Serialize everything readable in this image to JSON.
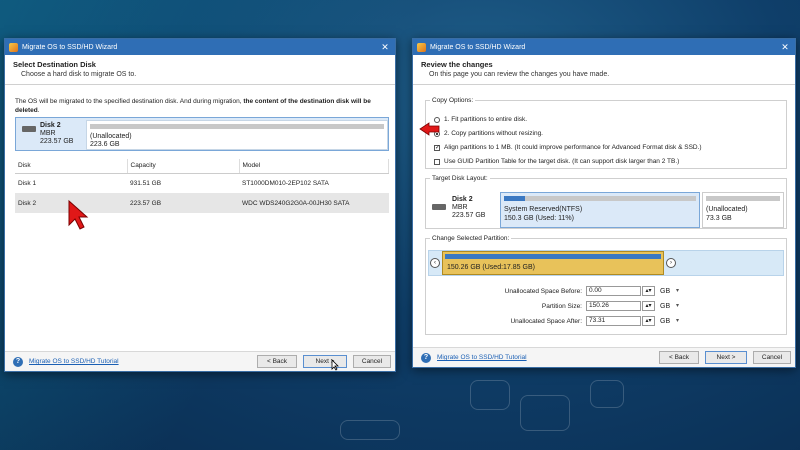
{
  "left_window": {
    "title": "Migrate OS to SSD/HD Wizard",
    "close_glyph": "✕",
    "header_title": "Select Destination Disk",
    "header_subtitle": "Choose a hard disk to migrate OS to.",
    "note_plain": "The OS will be migrated to the specified destination disk. And during migration, ",
    "note_bold": "the content of the destination disk will be deleted",
    "note_end": ".",
    "disk_card": {
      "name": "Disk 2",
      "type": "MBR",
      "size": "223.57 GB",
      "part_label": "(Unallocated)",
      "part_size": "223.6 GB"
    },
    "table": {
      "headers": [
        "Disk",
        "Capacity",
        "Model"
      ],
      "rows": [
        {
          "disk": "Disk 1",
          "capacity": "931.51 GB",
          "model": "ST1000DM010-2EP102 SATA"
        },
        {
          "disk": "Disk 2",
          "capacity": "223.57 GB",
          "model": "WDC WDS240G2G0A-00JH30 SATA"
        }
      ]
    },
    "help_glyph": "?",
    "tutorial_link": "Migrate OS to SSD/HD Tutorial",
    "back_label": "< Back",
    "next_label": "Next >",
    "cancel_label": "Cancel"
  },
  "right_window": {
    "title": "Migrate OS to SSD/HD Wizard",
    "close_glyph": "✕",
    "header_title": "Review the changes",
    "header_subtitle": "On this page you can review the changes you have made.",
    "copy_options": {
      "legend": "Copy Options:",
      "opt1": "1. Fit partitions to entire disk.",
      "opt2": "2. Copy partitions without resizing.",
      "opt3": "Align partitions to 1 MB.  (It could improve performance for Advanced Format disk & SSD.)",
      "opt4": "Use GUID Partition Table for the target disk. (It can support disk larger than 2 TB.)",
      "check_glyph": "✓"
    },
    "target_layout": {
      "legend": "Target Disk Layout:",
      "disk_name": "Disk 2",
      "disk_type": "MBR",
      "disk_size": "223.57 GB",
      "part1_label": "System Reserved(NTFS)",
      "part1_size": "150.3 GB (Used: 11%)",
      "part1_used_fraction": 0.11,
      "part2_label": "(Unallocated)",
      "part2_size": "73.3 GB"
    },
    "change_partition": {
      "legend": "Change Selected Partition:",
      "part_label": "150.26 GB (Used:17.85 GB)",
      "left_arrow": "‹",
      "right_arrow": "›",
      "fields": [
        {
          "label": "Unallocated Space Before:",
          "value": "0.00",
          "unit": "GB"
        },
        {
          "label": "Partition Size:",
          "value": "150.26",
          "unit": "GB"
        },
        {
          "label": "Unallocated Space After:",
          "value": "73.31",
          "unit": "GB"
        }
      ],
      "spin_glyph": "▴▾",
      "dropdown_glyph": "▾"
    },
    "help_glyph": "?",
    "tutorial_link": "Migrate OS to SSD/HD Tutorial",
    "back_label": "< Back",
    "next_label": "Next >",
    "cancel_label": "Cancel"
  },
  "colors": {
    "titlebar": "#2f6eb5",
    "accent_blue": "#7fb2e5",
    "partition_selected": "#e8c25a",
    "pointer_red": "#e01818"
  }
}
